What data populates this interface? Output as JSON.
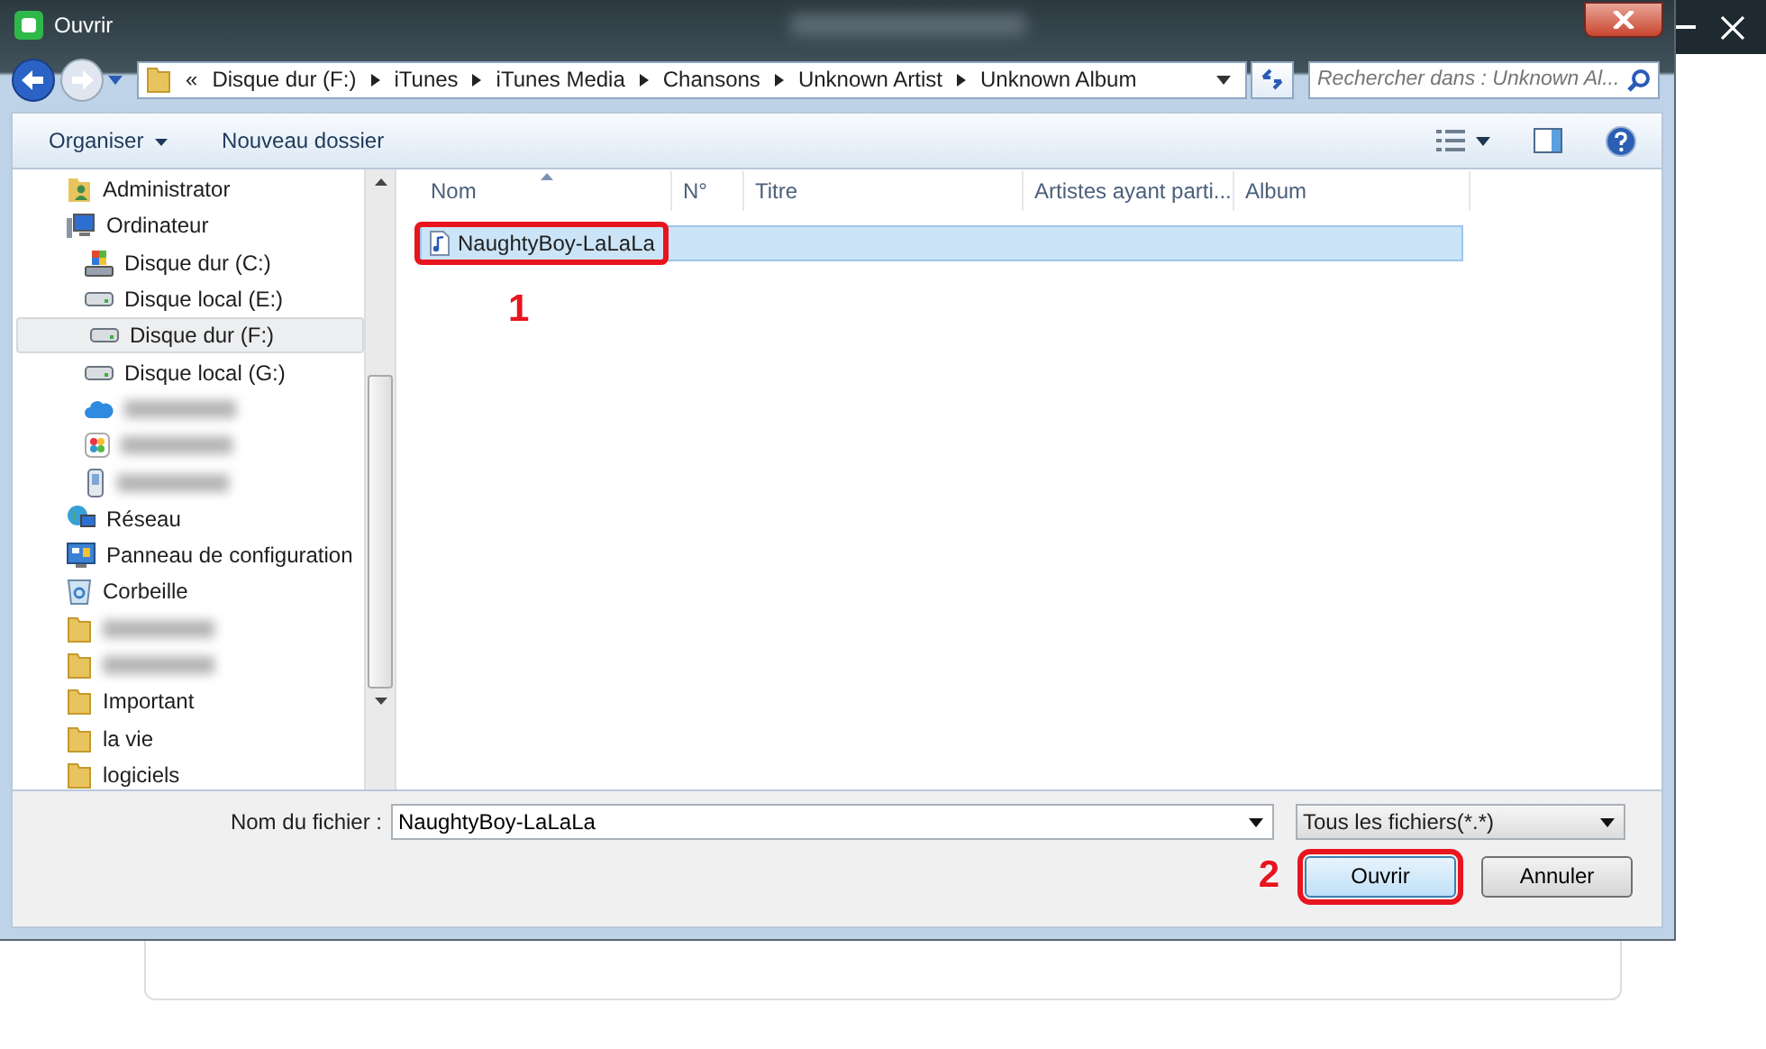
{
  "window": {
    "title": "Ouvrir"
  },
  "breadcrumb": {
    "overflow": "«",
    "segments": [
      "Disque dur (F:)",
      "iTunes",
      "iTunes Media",
      "Chansons",
      "Unknown Artist",
      "Unknown Album"
    ]
  },
  "search": {
    "placeholder": "Rechercher dans : Unknown Al..."
  },
  "toolbar": {
    "organize": "Organiser",
    "new_folder": "Nouveau dossier"
  },
  "sidebar": {
    "items": [
      {
        "kind": "user",
        "label": "Administrator",
        "selected": false
      },
      {
        "kind": "computer",
        "label": "Ordinateur",
        "selected": false,
        "children": [
          {
            "kind": "system-drive",
            "label": "Disque dur (C:)",
            "selected": false
          },
          {
            "kind": "drive",
            "label": "Disque local (E:)",
            "selected": false
          },
          {
            "kind": "drive",
            "label": "Disque dur (F:)",
            "selected": true
          },
          {
            "kind": "drive",
            "label": "Disque local (G:)",
            "selected": false
          },
          {
            "kind": "cloud",
            "selected": false
          },
          {
            "kind": "photos",
            "selected": false
          },
          {
            "kind": "device",
            "selected": false
          }
        ]
      },
      {
        "kind": "network",
        "label": "Réseau",
        "selected": false
      },
      {
        "kind": "control-panel",
        "label": "Panneau de configuration",
        "selected": false
      },
      {
        "kind": "trash",
        "label": "Corbeille",
        "selected": false
      },
      {
        "kind": "folder",
        "selected": false
      },
      {
        "kind": "folder",
        "selected": false
      },
      {
        "kind": "folder",
        "label": "Important",
        "selected": false
      },
      {
        "kind": "folder",
        "label": "la vie",
        "selected": false
      },
      {
        "kind": "folder",
        "label": "logiciels",
        "selected": false
      }
    ]
  },
  "file_list": {
    "columns": [
      "Nom",
      "N°",
      "Titre",
      "Artistes ayant parti...",
      "Album"
    ],
    "rows": [
      {
        "name": "NaughtyBoy-LaLaLa",
        "selected": true,
        "callout": "1"
      }
    ]
  },
  "footer": {
    "filename_label": "Nom du fichier :",
    "filename": "NaughtyBoy-LaLaLa",
    "filter": "Tous les fichiers(*.*)",
    "open": {
      "label": "Ouvrir",
      "callout": "2"
    },
    "cancel": "Annuler"
  }
}
